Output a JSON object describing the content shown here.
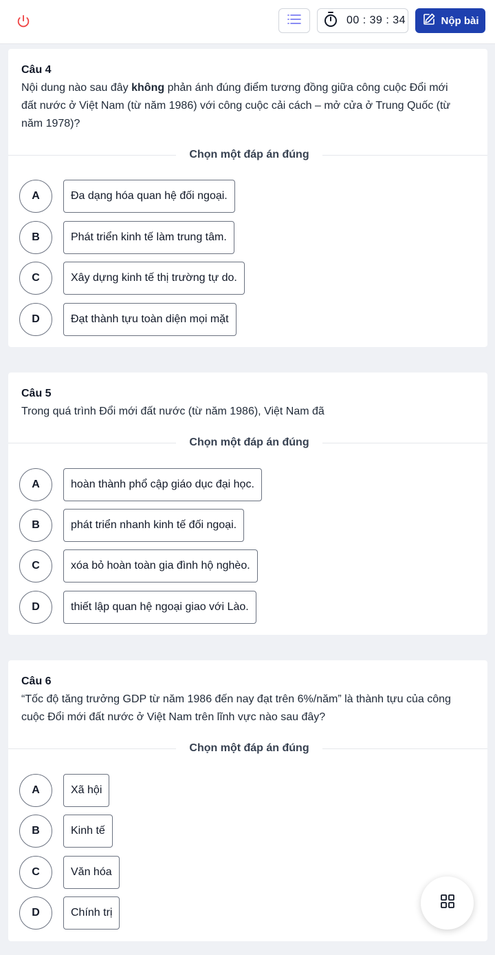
{
  "header": {
    "power_icon": "power-icon",
    "menu_icon": "list-icon",
    "timer_icon": "stopwatch-icon",
    "timer": "00 : 39 : 34",
    "submit_label": "Nộp bài",
    "submit_icon": "edit-icon",
    "accent_color": "#1e40af"
  },
  "choose_label": "Chọn một đáp án đúng",
  "questions": [
    {
      "title": "Câu 4",
      "text_before": "Nội dung nào sau đây ",
      "text_bold": "không",
      "text_after": " phản ánh đúng điểm tương đồng giữa công cuộc Đổi mới đất nước ở Việt Nam (từ năm 1986) với công cuộc cải cách – mở cửa ở Trung Quốc (từ năm 1978)?",
      "options": [
        {
          "letter": "A",
          "text": "Đa dạng hóa quan hệ đối ngoại."
        },
        {
          "letter": "B",
          "text": "Phát triển kinh tế làm trung tâm."
        },
        {
          "letter": "C",
          "text": "Xây dựng kinh tế thị trường tự do."
        },
        {
          "letter": "D",
          "text": "Đạt thành tựu toàn diện mọi mặt"
        }
      ]
    },
    {
      "title": "Câu 5",
      "text": "Trong quá trình Đổi mới đất nước (từ năm 1986), Việt Nam đã",
      "options": [
        {
          "letter": "A",
          "text": "hoàn thành phổ cập giáo dục đại học."
        },
        {
          "letter": "B",
          "text": "phát triển nhanh kinh tế đối ngoại."
        },
        {
          "letter": "C",
          "text": "xóa bỏ hoàn toàn gia đình hộ nghèo."
        },
        {
          "letter": "D",
          "text": "thiết lập quan hệ ngoại giao với Lào."
        }
      ]
    },
    {
      "title": "Câu 6",
      "text": "“Tốc độ tăng trưởng GDP từ năm 1986 đến nay đạt trên 6%/năm” là thành tựu của công cuộc Đổi mới đất nước ở Việt Nam trên lĩnh vực nào sau đây?",
      "options": [
        {
          "letter": "A",
          "text": "Xã hội"
        },
        {
          "letter": "B",
          "text": "Kinh tế"
        },
        {
          "letter": "C",
          "text": "Văn hóa"
        },
        {
          "letter": "D",
          "text": "Chính trị"
        }
      ]
    }
  ],
  "fab_icon": "grid-icon"
}
